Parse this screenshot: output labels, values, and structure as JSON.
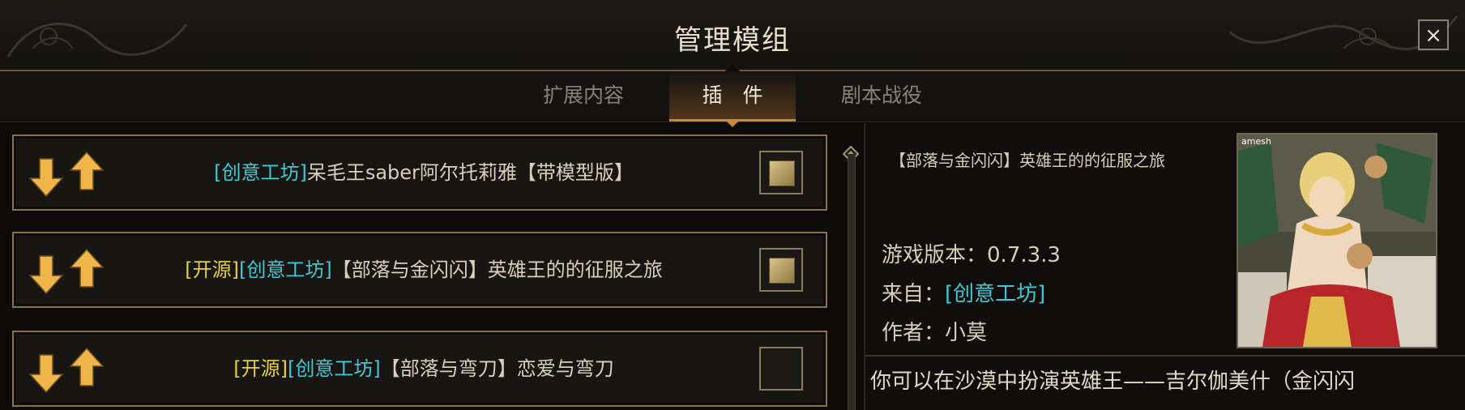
{
  "header": {
    "title": "管理模组",
    "close_label": "×"
  },
  "tabs": [
    {
      "label": "扩展内容",
      "active": false
    },
    {
      "label": "插　件",
      "active": true
    },
    {
      "label": "剧本战役",
      "active": false
    }
  ],
  "mods": [
    {
      "tags": [
        {
          "text": "[创意工坊]",
          "color": "#3ec9d6"
        }
      ],
      "name": "呆毛王saber阿尔托莉雅【带模型版】",
      "checked": true
    },
    {
      "tags": [
        {
          "text": "[开源]",
          "color": "#e6cf3a"
        },
        {
          "text": "[创意工坊]",
          "color": "#3ec9d6"
        }
      ],
      "name": "【部落与金闪闪】英雄王的的征服之旅",
      "checked": true
    },
    {
      "tags": [
        {
          "text": "[开源]",
          "color": "#e6cf3a"
        },
        {
          "text": "[创意工坊]",
          "color": "#3ec9d6"
        }
      ],
      "name": "【部落与弯刀】恋爱与弯刀",
      "checked": false
    }
  ],
  "detail": {
    "title": "【部落与金闪闪】英雄王的的征服之旅",
    "version_label": "游戏版本：",
    "version_value": "0.7.3.3",
    "source_label": "来自：",
    "source_value": "[创意工坊]",
    "author_label": "作者：",
    "author_value": "小莫",
    "cover_caption": "amesh",
    "description": "你可以在沙漠中扮演英雄王——吉尔伽美什（金闪闪"
  },
  "colors": {
    "accent": "#c78a3c",
    "cyan": "#3ec9d6",
    "yellow": "#e6cf3a",
    "border": "#8c7346"
  }
}
